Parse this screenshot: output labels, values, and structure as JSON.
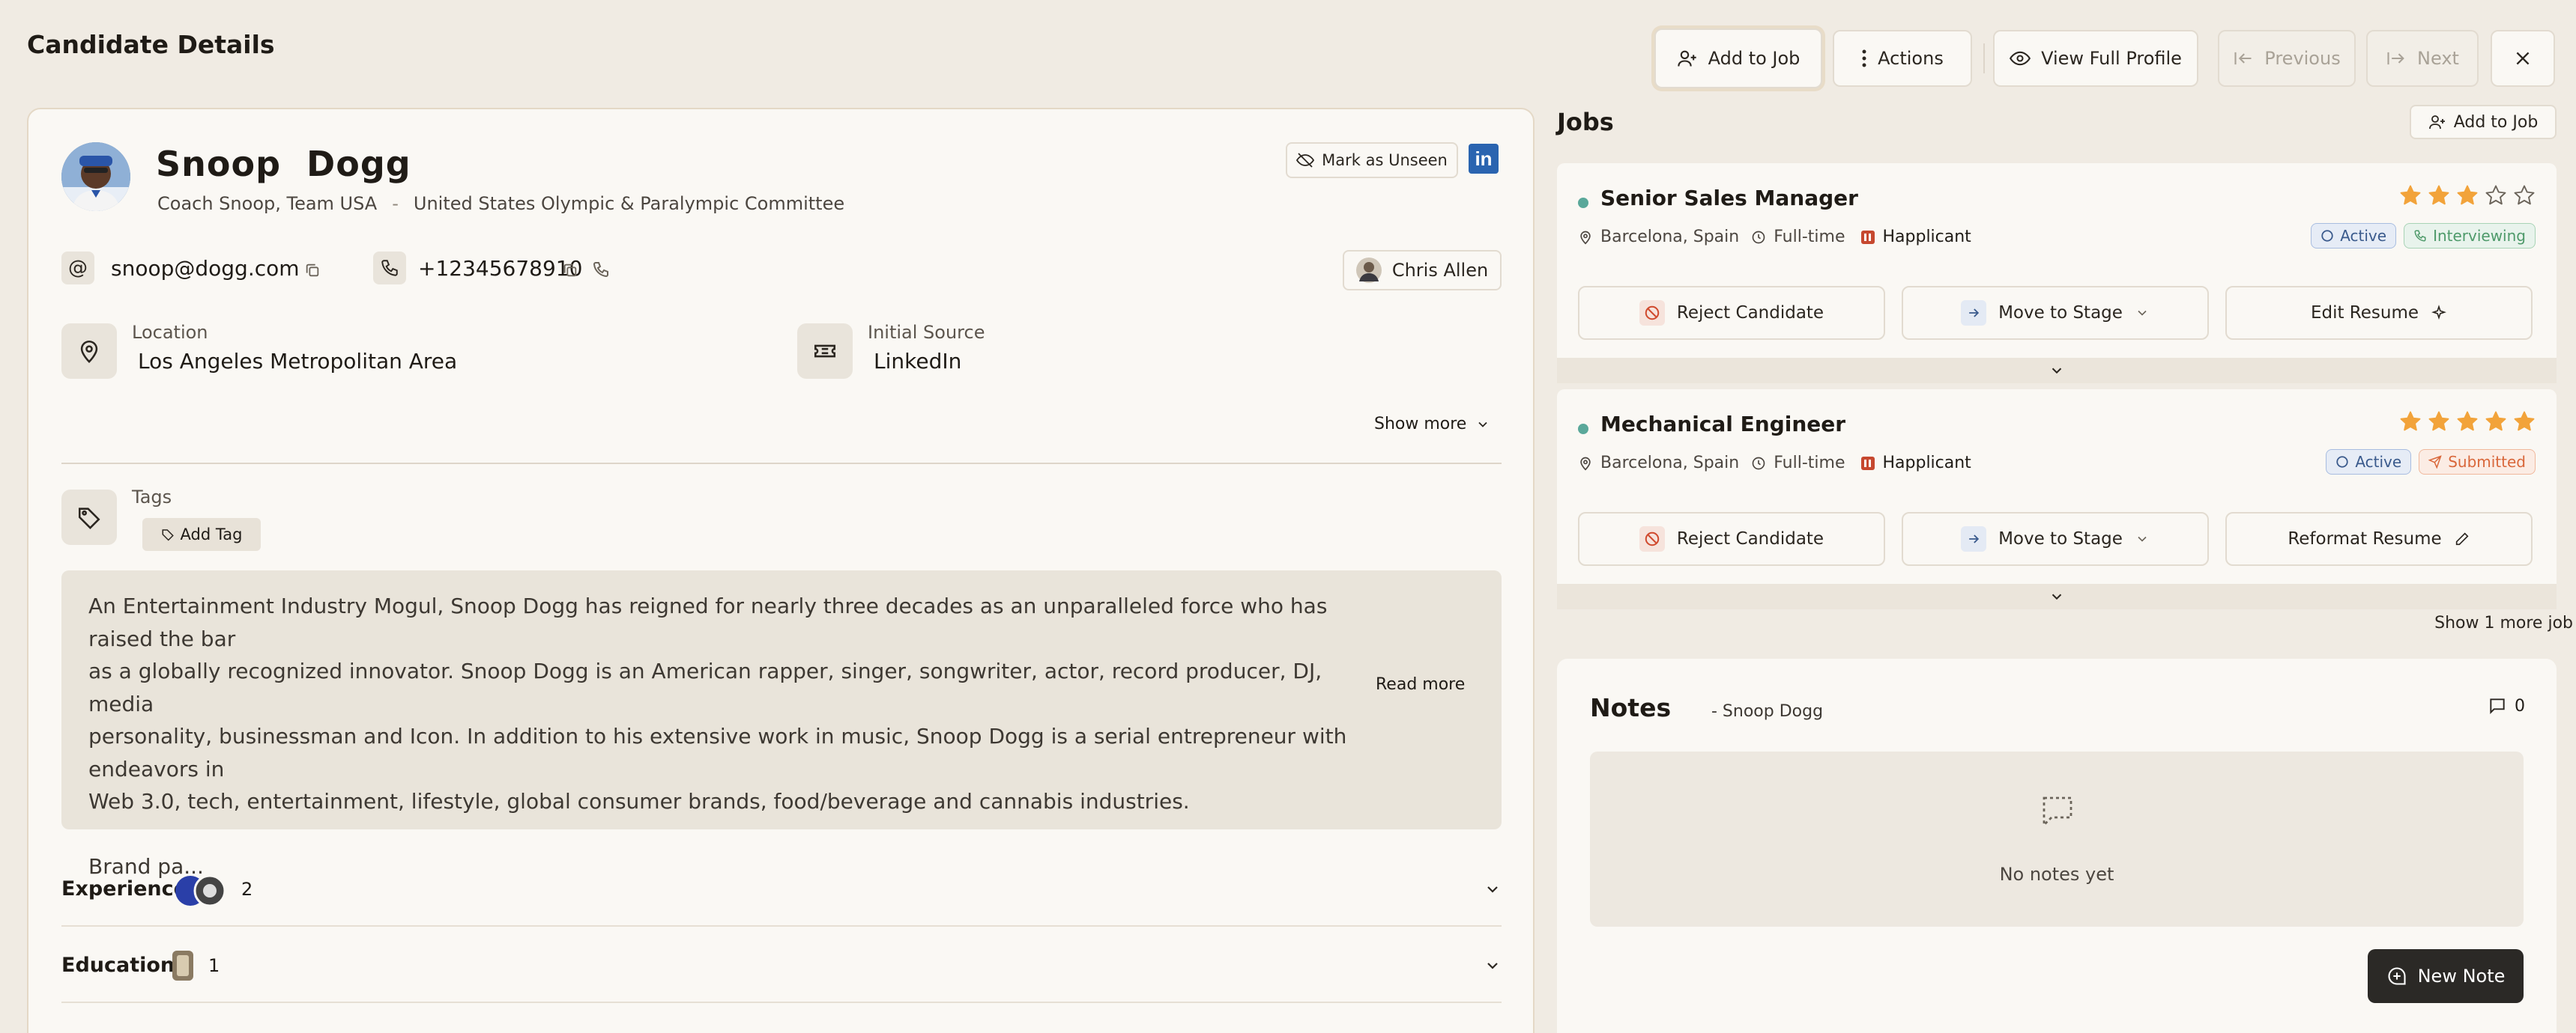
{
  "header": {
    "title": "Candidate Details",
    "add_to_job": "Add to Job",
    "actions": "Actions",
    "view_full_profile": "View Full Profile",
    "previous": "Previous",
    "next": "Next"
  },
  "candidate": {
    "name": "Snoop  Dogg",
    "headline": "Coach Snoop, Team USA",
    "company": "United States Olympic & Paralympic Committee",
    "mark_unseen": "Mark as Unseen",
    "linkedin": "in",
    "email": "snoop@dogg.com",
    "phone": "+12345678910",
    "owner": "Chris Allen",
    "location_label": "Location",
    "location_value": "Los Angeles Metropolitan Area",
    "source_label": "Initial Source",
    "source_value": "LinkedIn",
    "show_more": "Show more",
    "tags_label": "Tags",
    "add_tag": "Add Tag",
    "bio": "An Entertainment Industry Mogul, Snoop Dogg has reigned for nearly three decades as an unparalleled force who has raised the bar\nas a globally recognized innovator. Snoop Dogg is an American rapper, singer, songwriter, actor, record producer, DJ, media\npersonality, businessman and Icon. In addition to his extensive work in music, Snoop Dogg is a serial entrepreneur with endeavors in\nWeb 3.0, tech, entertainment, lifestyle, global consumer brands, food/beverage and cannabis industries.\n\nBrand pa...",
    "read_more": "Read more",
    "sections": [
      {
        "title": "Experience",
        "count": "2"
      },
      {
        "title": "Education",
        "count": "1"
      }
    ]
  },
  "jobs": {
    "title": "Jobs",
    "add_to_job": "Add to Job",
    "show_more": "Show 1 more job",
    "items": [
      {
        "title": "Senior Sales Manager",
        "location": "Barcelona, Spain",
        "type": "Full-time",
        "company": "Happlicant",
        "rating": 3,
        "status": "Active",
        "stage": "Interviewing",
        "reject": "Reject Candidate",
        "move": "Move to Stage",
        "resume": "Edit Resume"
      },
      {
        "title": "Mechanical Engineer",
        "location": "Barcelona, Spain",
        "type": "Full-time",
        "company": "Happlicant",
        "rating": 5,
        "status": "Active",
        "stage": "Submitted",
        "reject": "Reject Candidate",
        "move": "Move to Stage",
        "resume": "Reformat Resume"
      }
    ]
  },
  "notes": {
    "title": "Notes",
    "subtitle": "- Snoop Dogg",
    "count": "0",
    "empty": "No notes yet",
    "new_note": "New Note"
  },
  "colors": {
    "background": "#f0ebe3",
    "card": "#faf8f4",
    "star": "#f2a33a",
    "active": "#3a5a8c",
    "interviewing": "#4e9a6a",
    "submitted": "#d9673a",
    "dark_button": "#2b2926"
  }
}
